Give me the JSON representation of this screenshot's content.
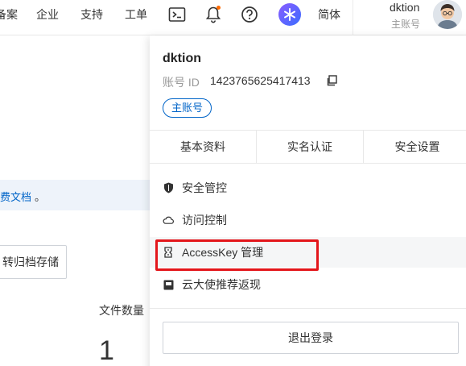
{
  "nav": {
    "items": [
      "备案",
      "企业",
      "支持",
      "工单"
    ],
    "language": "简体",
    "username": "dktion",
    "account_type": "主账号",
    "icons": [
      "terminal-icon",
      "bell-icon",
      "help-icon",
      "ai-assistant-icon"
    ],
    "notification_dot_color": "#ff6a00"
  },
  "background": {
    "notice_link": "费文档",
    "notice_suffix": "。",
    "archive_button": "转归档存储",
    "file_count_label": "文件数量",
    "file_count_value": "1"
  },
  "dropdown": {
    "name": "dktion",
    "id_label": "账号 ID",
    "id_value": "1423765625417413",
    "badge": "主账号",
    "tabs": [
      "基本资料",
      "实名认证",
      "安全设置"
    ],
    "menu": [
      {
        "label": "安全管控",
        "icon": "shield-icon"
      },
      {
        "label": "访问控制",
        "icon": "cloud-icon"
      },
      {
        "label": "AccessKey 管理",
        "icon": "key-icon"
      },
      {
        "label": "云大使推荐返现",
        "icon": "gift-icon"
      }
    ],
    "logout": "退出登录"
  },
  "colors": {
    "accent": "#0064c8",
    "highlight": "#e3161b"
  }
}
